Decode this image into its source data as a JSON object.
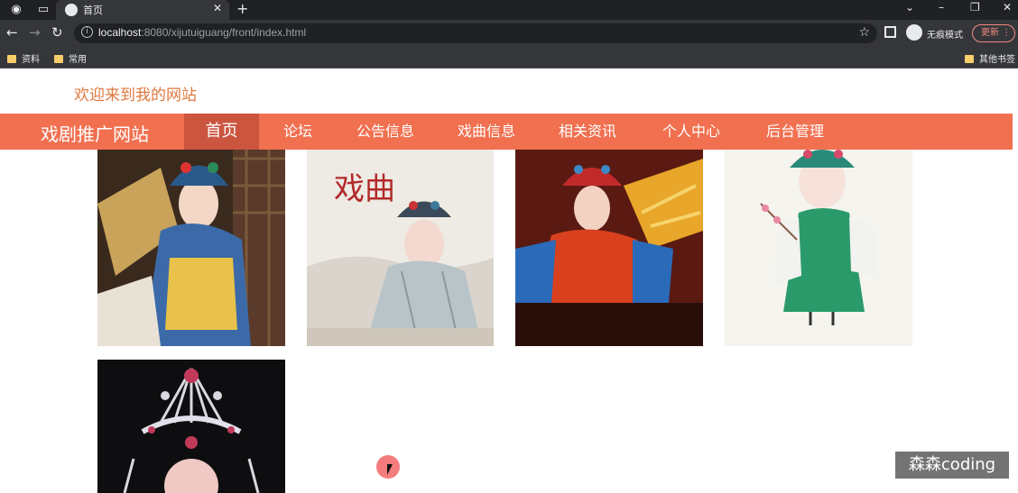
{
  "browser": {
    "tab_title": "首页",
    "url_host": "localhost",
    "url_rest": ":8080/xijutuiguang/front/index.html",
    "incognito_label": "无痕模式",
    "update_label": "更新",
    "bookmarks": [
      "资料",
      "常用"
    ],
    "other_bookmarks": "其他书签"
  },
  "site": {
    "welcome": "欢迎来到我的网站",
    "brand": "戏剧推广网站",
    "nav": [
      {
        "label": "首页",
        "active": true
      },
      {
        "label": "论坛"
      },
      {
        "label": "公告信息"
      },
      {
        "label": "戏曲信息"
      },
      {
        "label": "相关资讯"
      },
      {
        "label": "个人中心"
      },
      {
        "label": "后台管理"
      }
    ]
  },
  "gallery": {
    "items": [
      {
        "name": "opera-image-1"
      },
      {
        "name": "opera-image-2",
        "caption": "戏曲"
      },
      {
        "name": "opera-image-3"
      },
      {
        "name": "opera-image-4"
      },
      {
        "name": "opera-image-5"
      }
    ]
  },
  "watermark": "森森coding"
}
